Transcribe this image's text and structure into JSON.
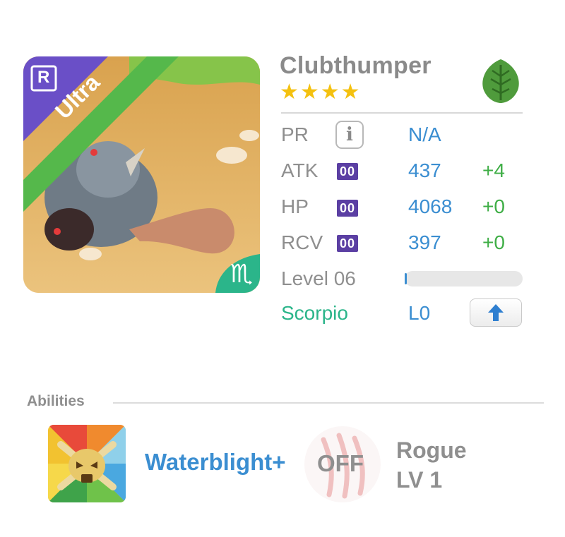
{
  "monster": {
    "name": "Clubthumper",
    "stars": "★★★★",
    "star_count": 4,
    "rarity": "Ultra",
    "element_icon": "leaf-icon",
    "portrait_badge": "R",
    "zodiac_glyph": "♏"
  },
  "stats": {
    "pr": {
      "label": "PR",
      "value": "N/A",
      "info_icon": "i"
    },
    "atk": {
      "label": "ATK",
      "badge": "00",
      "value": "437",
      "bonus": "+4"
    },
    "hp": {
      "label": "HP",
      "badge": "00",
      "value": "4068",
      "bonus": "+0"
    },
    "rcv": {
      "label": "RCV",
      "badge": "00",
      "value": "397",
      "bonus": "+0"
    },
    "level": {
      "label": "Level 06",
      "progress_fraction": 0.02
    },
    "sign": {
      "label": "Scorpio",
      "value": "L0"
    }
  },
  "abilities": {
    "title": "Abilities",
    "ability_name": "Waterblight+",
    "skill_state": "OFF",
    "skill_name": "Rogue",
    "skill_level": "LV 1"
  },
  "colors": {
    "blue": "#3b8ed1",
    "green": "#3fae46",
    "teal": "#2bb58a",
    "gray": "#8f8f8f",
    "star": "#f4c10f",
    "badge": "#5b3fa3"
  }
}
